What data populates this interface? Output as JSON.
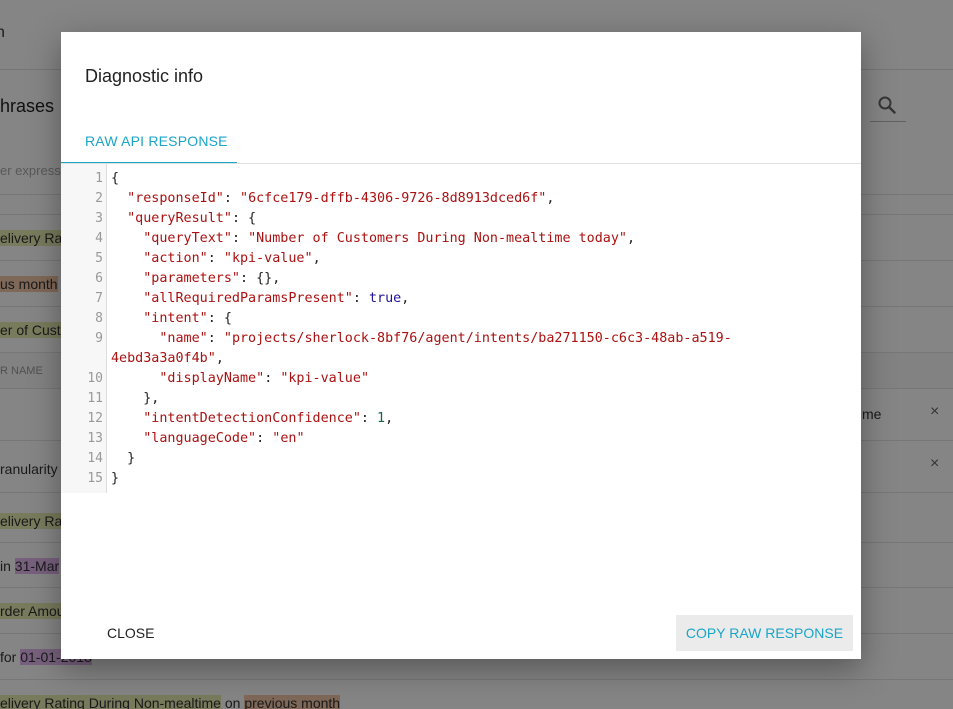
{
  "background": {
    "topbar_text": "n",
    "heading": "hrases",
    "rows": [
      {
        "text": "er express",
        "style": "muted"
      },
      {
        "text": "elivery Rat",
        "style": "hl-y"
      },
      {
        "text": "us month",
        "style": "hl-o"
      },
      {
        "text": "er of Custo",
        "style": "hl-y"
      },
      {
        "text": "R NAME",
        "style": "small"
      },
      {
        "text": "ranularity",
        "style": "plain"
      },
      {
        "text": "elivery Rat",
        "style": "hl-y"
      },
      {
        "text": "in",
        "style": "plain",
        "extra": "31-Mar"
      },
      {
        "text": "rder Amou",
        "style": "hl-y"
      },
      {
        "text": "for",
        "style": "plain",
        "extra": "01-01-2018"
      },
      {
        "text": "elivery Rating During Non-mealtime",
        "style": "hl-y",
        "extra_plain": " on ",
        "extra2": "previous month"
      }
    ],
    "right_text": "me",
    "remove_symbol": "×"
  },
  "dialog": {
    "title": "Diagnostic info",
    "tab_label": "RAW API RESPONSE",
    "close_label": "CLOSE",
    "copy_label": "COPY RAW RESPONSE",
    "line_numbers": [
      "1",
      "2",
      "3",
      "4",
      "5",
      "6",
      "7",
      "8",
      "9",
      "10",
      "11",
      "12",
      "13",
      "14",
      "15"
    ]
  },
  "response": {
    "responseId": "6cfce179-dffb-4306-9726-8d8913dced6f",
    "queryText": "Number of Customers During Non-mealtime today",
    "action": "kpi-value",
    "allRequiredParamsPresent": "true",
    "intent_name_part1": "projects/sherlock-8bf76/agent/intents/ba271150-c6c3-48ab-a519-",
    "intent_name_part2": "4ebd3a3a0f4b",
    "displayName": "kpi-value",
    "intentDetectionConfidence": "1",
    "languageCode": "en"
  },
  "colors": {
    "accent": "#1aa5c8",
    "json_key": "#aa1111",
    "json_bool": "#221199",
    "json_number": "#116644"
  }
}
